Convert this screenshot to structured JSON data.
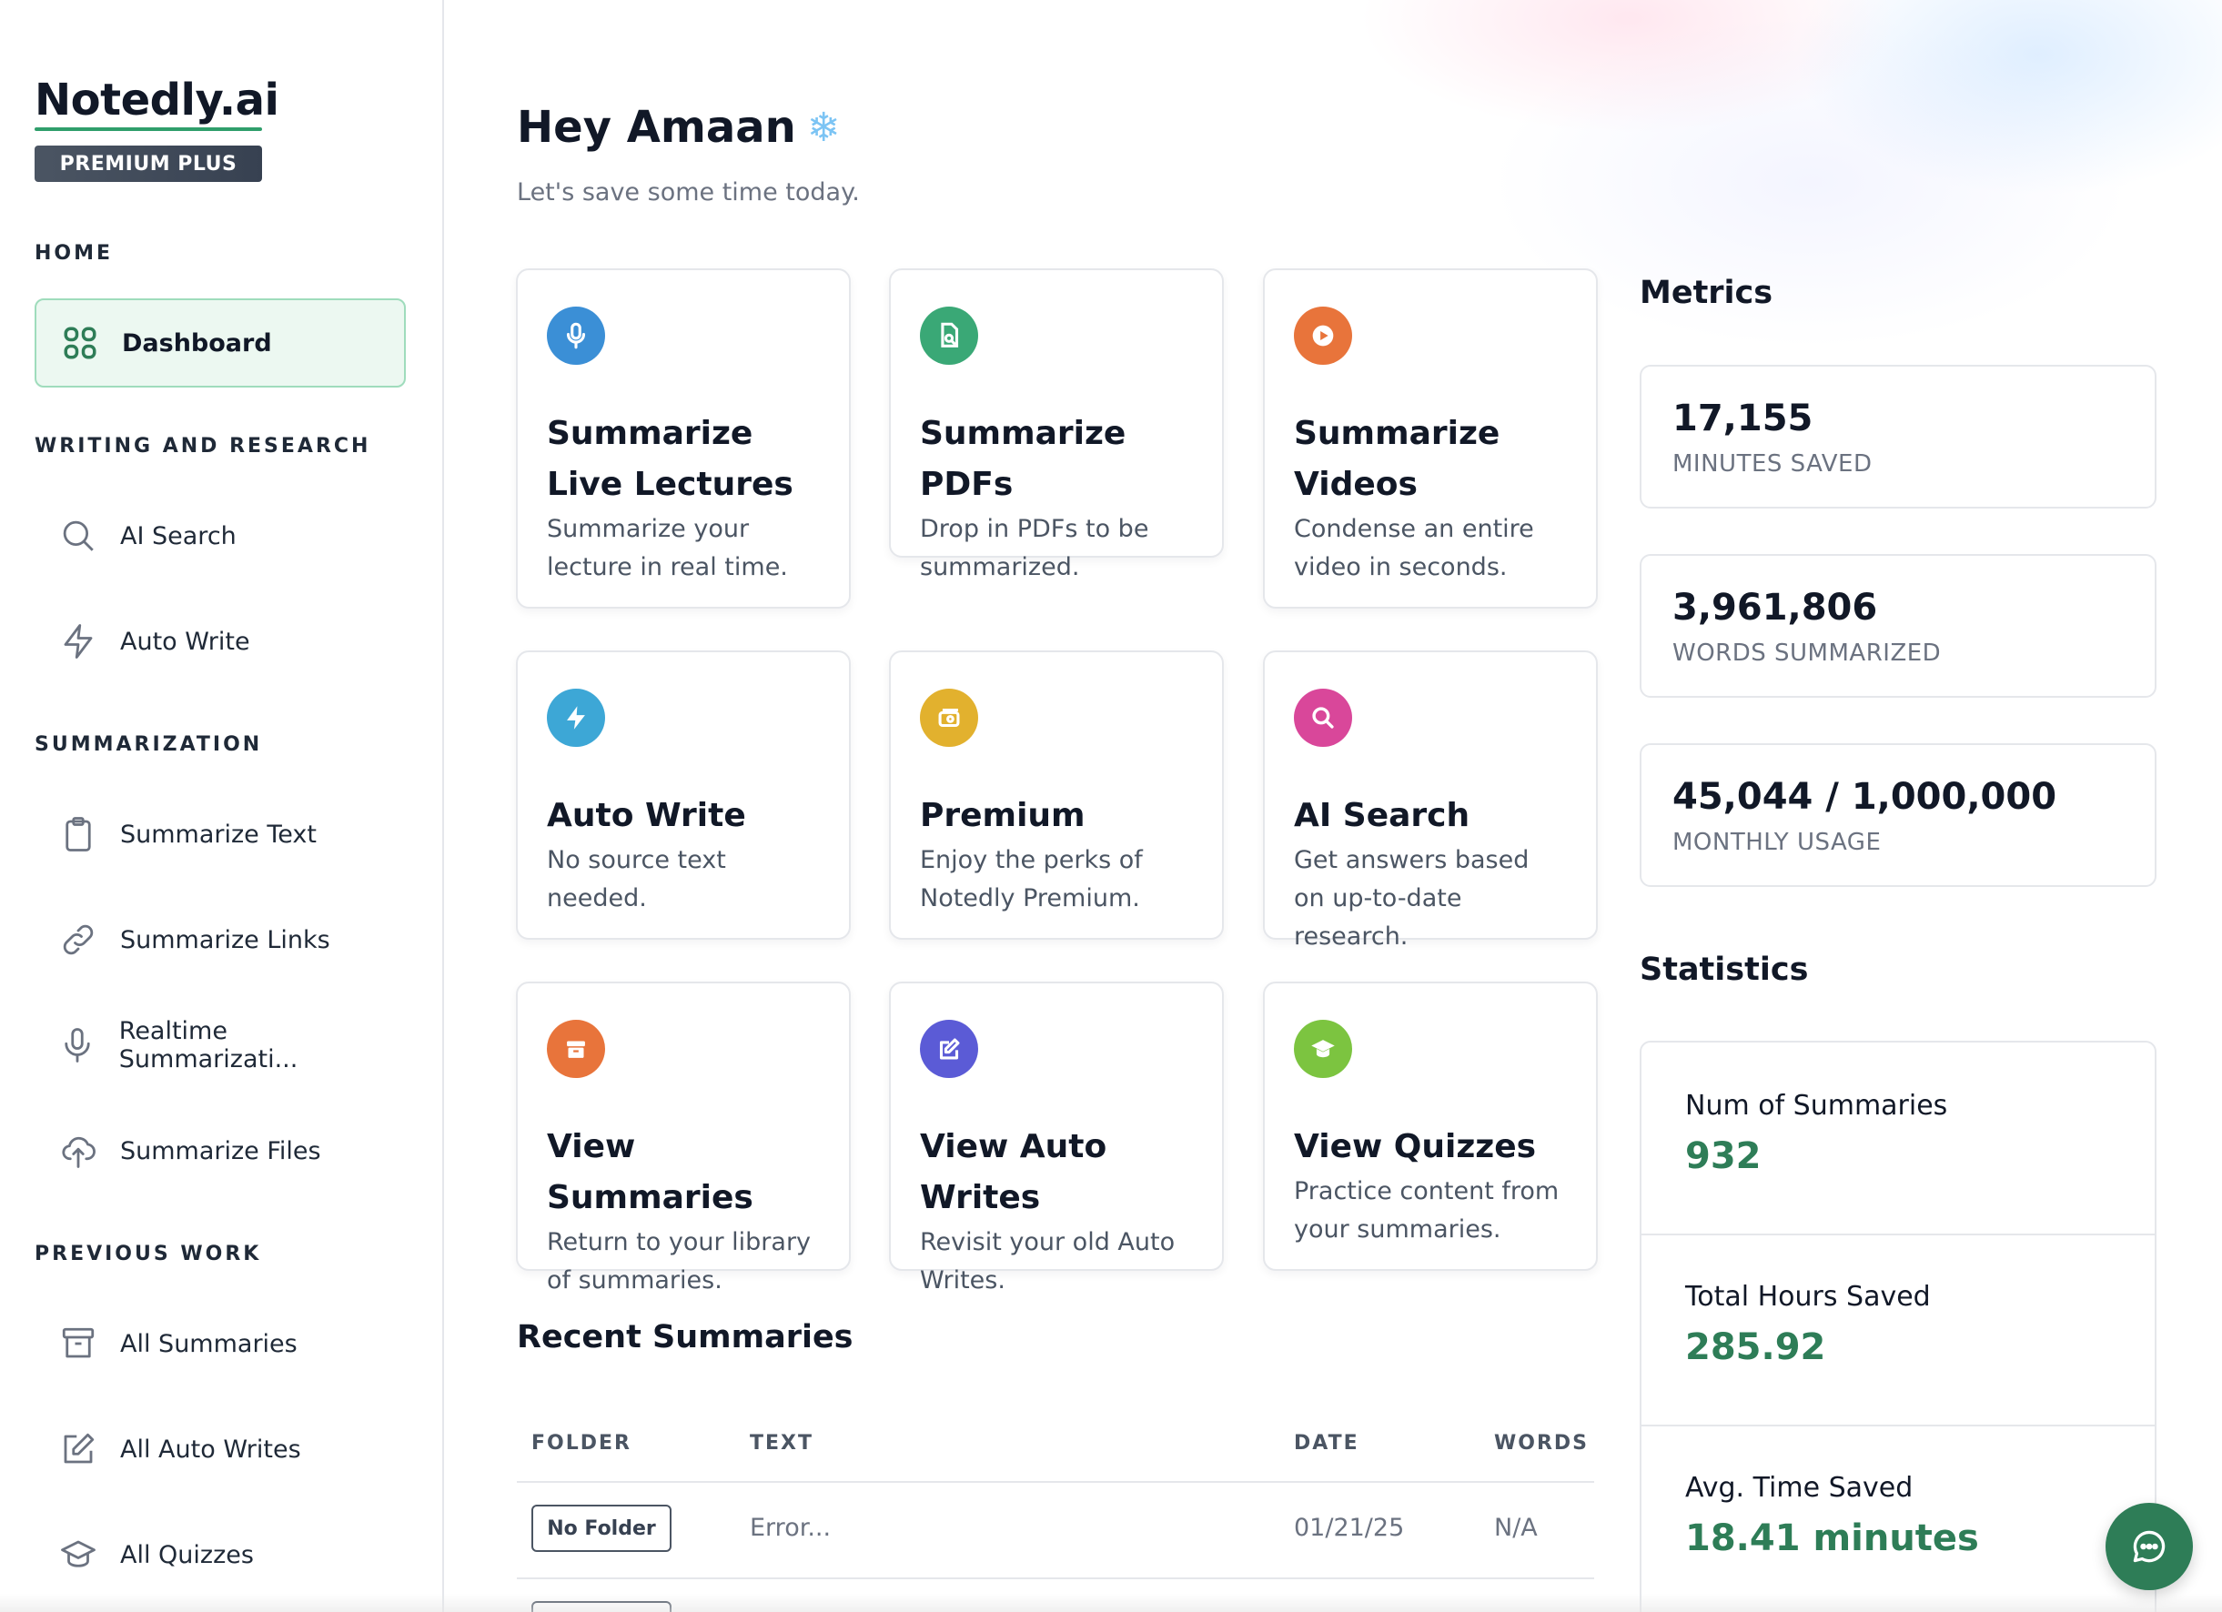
{
  "brand": {
    "name": "Notedly.ai",
    "plan": "PREMIUM PLUS",
    "accent": "#2e7d57"
  },
  "sidebar": {
    "sections": [
      {
        "label": "HOME",
        "items": [
          {
            "label": "Dashboard",
            "icon": "grid-icon",
            "active": true
          }
        ]
      },
      {
        "label": "WRITING AND RESEARCH",
        "items": [
          {
            "label": "AI Search",
            "icon": "search-icon"
          },
          {
            "label": "Auto Write",
            "icon": "lightning-icon"
          }
        ]
      },
      {
        "label": "SUMMARIZATION",
        "items": [
          {
            "label": "Summarize Text",
            "icon": "clipboard-icon"
          },
          {
            "label": "Summarize Links",
            "icon": "link-icon"
          },
          {
            "label": "Realtime Summarizati...",
            "icon": "microphone-icon"
          },
          {
            "label": "Summarize Files",
            "icon": "cloud-upload-icon"
          }
        ]
      },
      {
        "label": "PREVIOUS WORK",
        "items": [
          {
            "label": "All Summaries",
            "icon": "archive-icon"
          },
          {
            "label": "All Auto Writes",
            "icon": "edit-icon"
          },
          {
            "label": "All Quizzes",
            "icon": "graduation-cap-icon"
          }
        ]
      }
    ]
  },
  "header": {
    "greeting": "Hey Amaan",
    "greeting_icon": "snowflake-icon",
    "subtitle": "Let's save some time today."
  },
  "cards": [
    {
      "title": "Summarize Live Lectures",
      "desc": "Summarize your lecture in real time.",
      "icon": "microphone-icon",
      "color": "#3b8fd6"
    },
    {
      "title": "Summarize PDFs",
      "desc": "Drop in PDFs to be summarized.",
      "icon": "pdf-search-icon",
      "color": "#3aa876"
    },
    {
      "title": "Summarize Videos",
      "desc": "Condense an entire video in seconds.",
      "icon": "play-icon",
      "color": "#e8743b"
    },
    {
      "title": "Auto Write",
      "desc": "No source text needed.",
      "icon": "lightning-icon",
      "color": "#3da7d6"
    },
    {
      "title": "Premium",
      "desc": "Enjoy the perks of Notedly Premium.",
      "icon": "money-icon",
      "color": "#e2b12e"
    },
    {
      "title": "AI Search",
      "desc": "Get answers based on up-to-date research.",
      "icon": "search-icon",
      "color": "#d9479a"
    },
    {
      "title": "View Summaries",
      "desc": "Return to your library of summaries.",
      "icon": "archive-icon",
      "color": "#e8743b"
    },
    {
      "title": "View Auto Writes",
      "desc": "Revisit your old Auto Writes.",
      "icon": "edit-icon",
      "color": "#5b5bd6"
    },
    {
      "title": "View Quizzes",
      "desc": "Practice content from your summaries.",
      "icon": "graduation-cap-icon",
      "color": "#7cc440"
    }
  ],
  "recent": {
    "title": "Recent Summaries",
    "columns": [
      "FOLDER",
      "TEXT",
      "DATE",
      "WORDS"
    ],
    "rows": [
      {
        "folder": "No Folder",
        "text": "Error...",
        "date": "01/21/25",
        "words": "N/A"
      }
    ]
  },
  "metrics": {
    "title": "Metrics",
    "items": [
      {
        "value": "17,155",
        "label": "MINUTES SAVED"
      },
      {
        "value": "3,961,806",
        "label": "WORDS SUMMARIZED"
      },
      {
        "value": "45,044 / 1,000,000",
        "label": "MONTHLY USAGE"
      }
    ]
  },
  "statistics": {
    "title": "Statistics",
    "items": [
      {
        "label": "Num of Summaries",
        "value": "932"
      },
      {
        "label": "Total Hours Saved",
        "value": "285.92"
      },
      {
        "label": "Avg. Time Saved",
        "value": "18.41 minutes"
      }
    ]
  },
  "chat": {
    "icon": "chat-bubble-icon"
  }
}
